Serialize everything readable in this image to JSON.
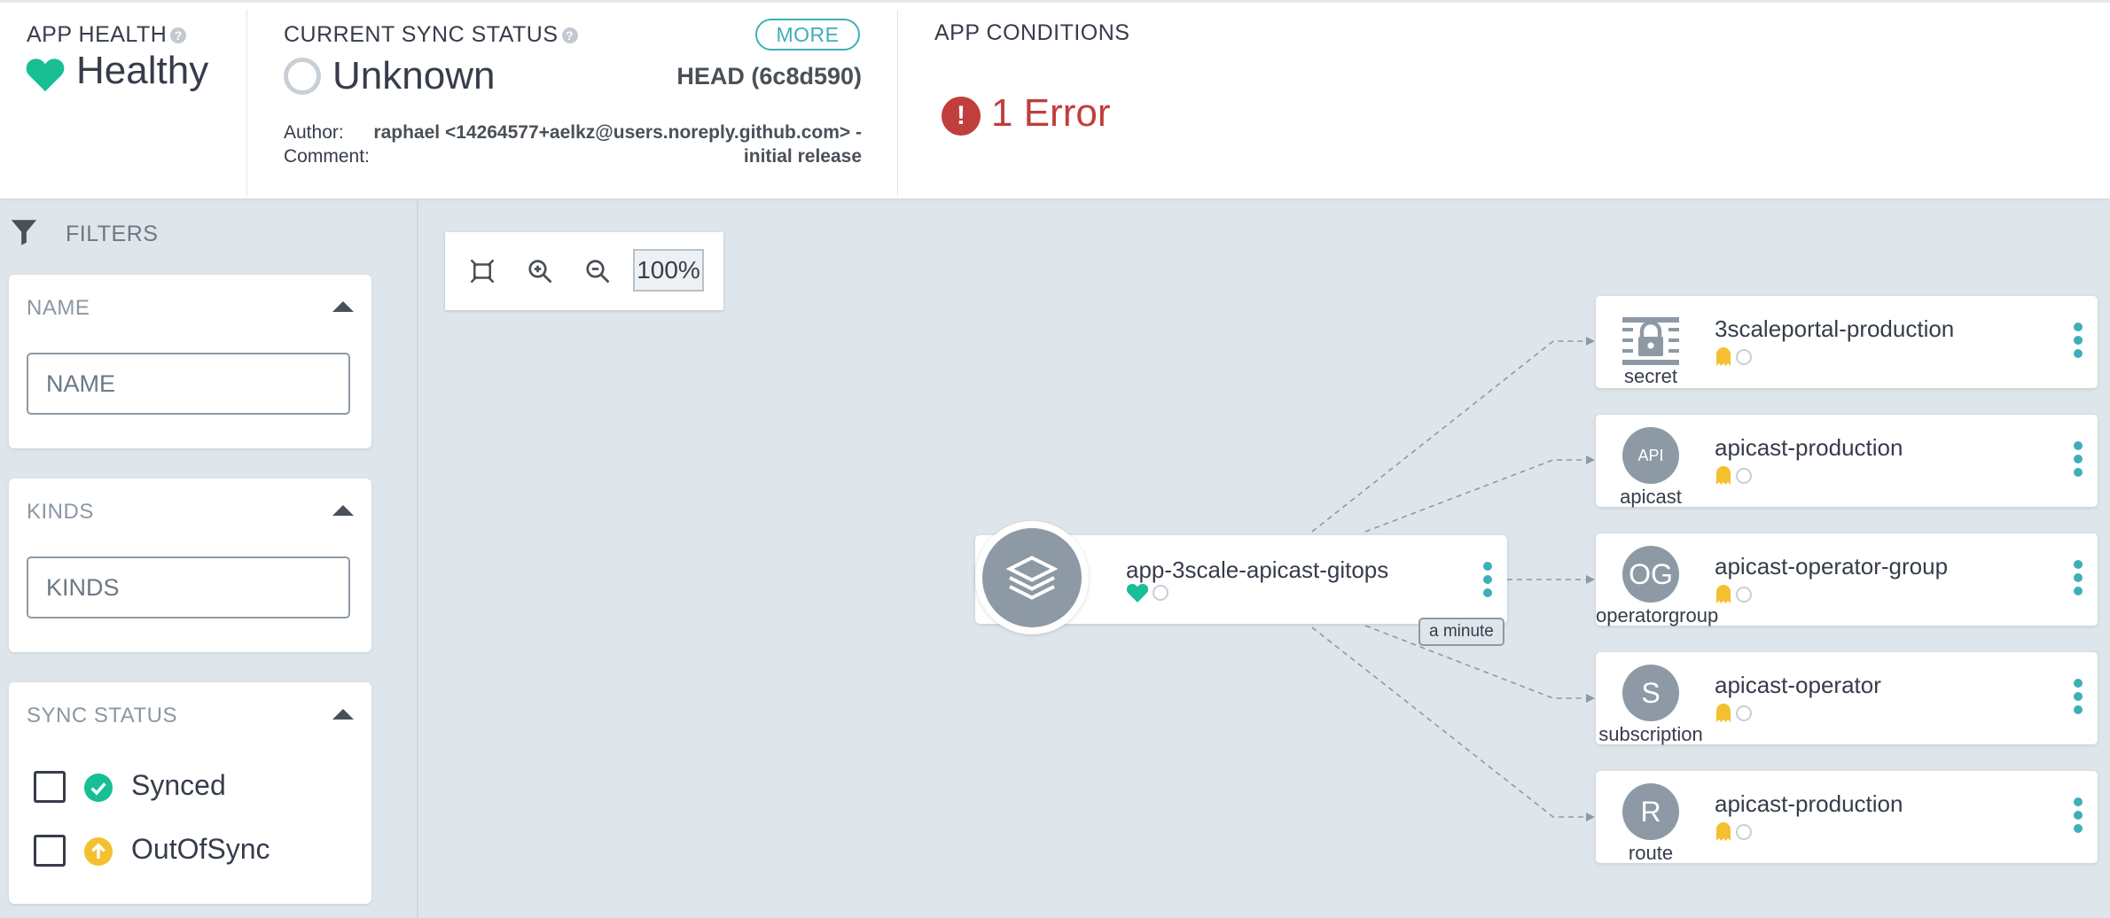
{
  "health": {
    "label": "APP HEALTH",
    "value": "Healthy",
    "color": "#18be94"
  },
  "sync": {
    "label": "CURRENT SYNC STATUS",
    "value": "Unknown",
    "more_label": "MORE",
    "revision": "HEAD (6c8d590)",
    "author_key": "Author:",
    "author_value": "raphael <14264577+aelkz@users.noreply.github.com> -",
    "comment_key": "Comment:",
    "comment_value": "initial release"
  },
  "conditions": {
    "label": "APP CONDITIONS",
    "value": "1 Error",
    "color": "#c03e3c"
  },
  "filters": {
    "header": "FILTERS",
    "name_title": "NAME",
    "name_placeholder": "NAME",
    "kinds_title": "KINDS",
    "kinds_placeholder": "KINDS",
    "sync_title": "SYNC STATUS",
    "options": [
      {
        "label": "Synced",
        "icon": "check-circle-icon",
        "color": "#18be94"
      },
      {
        "label": "OutOfSync",
        "icon": "arrow-up-circle-icon",
        "color": "#f4c030"
      }
    ]
  },
  "zoom": {
    "level": "100%"
  },
  "graph": {
    "app": {
      "name": "app-3scale-apicast-gitops",
      "age": "a minute"
    },
    "resources": [
      {
        "name": "3scaleportal-production",
        "kind": "secret",
        "icon_text": ""
      },
      {
        "name": "apicast-production",
        "kind": "apicast",
        "icon_text": "API"
      },
      {
        "name": "apicast-operator-group",
        "kind": "operatorgroup",
        "icon_text": "OG"
      },
      {
        "name": "apicast-operator",
        "kind": "subscription",
        "icon_text": "S"
      },
      {
        "name": "apicast-production",
        "kind": "route",
        "icon_text": "R"
      }
    ]
  },
  "colors": {
    "accent": "#3dafb7",
    "missing": "#f4c030",
    "node_icon": "#8d9aa5"
  }
}
